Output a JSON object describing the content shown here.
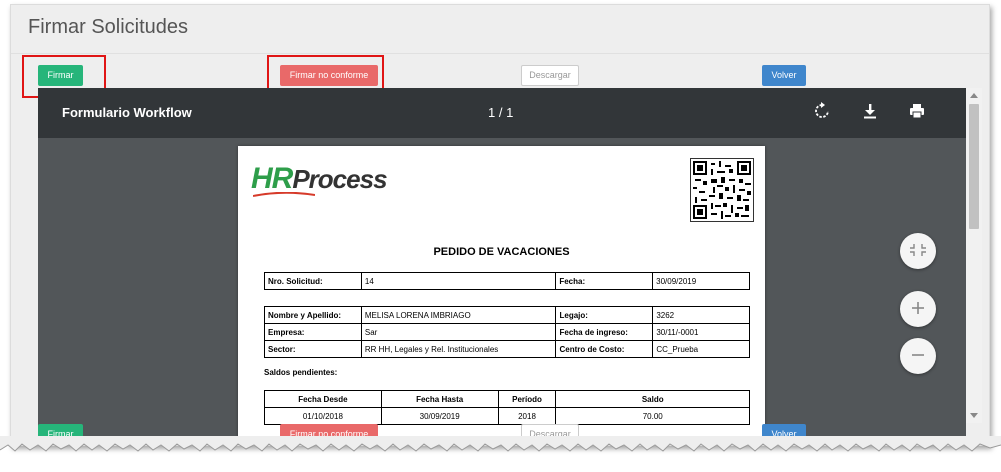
{
  "page": {
    "title": "Firmar Solicitudes"
  },
  "actions": {
    "firmar": "Firmar",
    "firmar_no_conforme": "Firmar no conforme",
    "descargar": "Descargar",
    "volver": "Volver"
  },
  "colors": {
    "firmar": "#26b57a",
    "firmar_no_conforme": "#e96969",
    "volver": "#3f86cc",
    "highlight": "#e01515"
  },
  "viewer": {
    "title": "Formulario Workflow",
    "page_indicator": "1 / 1",
    "icons": [
      "rotate-icon",
      "download-icon",
      "print-icon"
    ],
    "zoom_icons": [
      "fit-to-page-icon",
      "zoom-in-icon",
      "zoom-out-icon"
    ]
  },
  "document": {
    "logo": {
      "hr": "HR",
      "process": "Process"
    },
    "title": "PEDIDO DE VACACIONES",
    "request": {
      "nro_label": "Nro. Solicitud:",
      "nro_value": "14",
      "fecha_label": "Fecha:",
      "fecha_value": "30/09/2019"
    },
    "employee": {
      "nombre_label": "Nombre y Apellido:",
      "nombre_value": "MELISA LORENA IMBRIAGO",
      "legajo_label": "Legajo:",
      "legajo_value": "3262",
      "empresa_label": "Empresa:",
      "empresa_value": "Sar",
      "fecha_ingreso_label": "Fecha de ingreso:",
      "fecha_ingreso_value": "30/11/-0001",
      "sector_label": "Sector:",
      "sector_value": "RR HH, Legales y Rel. Institucionales",
      "centro_label": "Centro de Costo:",
      "centro_value": "CC_Prueba"
    },
    "saldos_label": "Saldos pendientes:",
    "saldos": {
      "headers": [
        "Fecha Desde",
        "Fecha Hasta",
        "Período",
        "Saldo"
      ],
      "rows": [
        [
          "01/10/2018",
          "30/09/2019",
          "2018",
          "70.00"
        ]
      ]
    }
  }
}
